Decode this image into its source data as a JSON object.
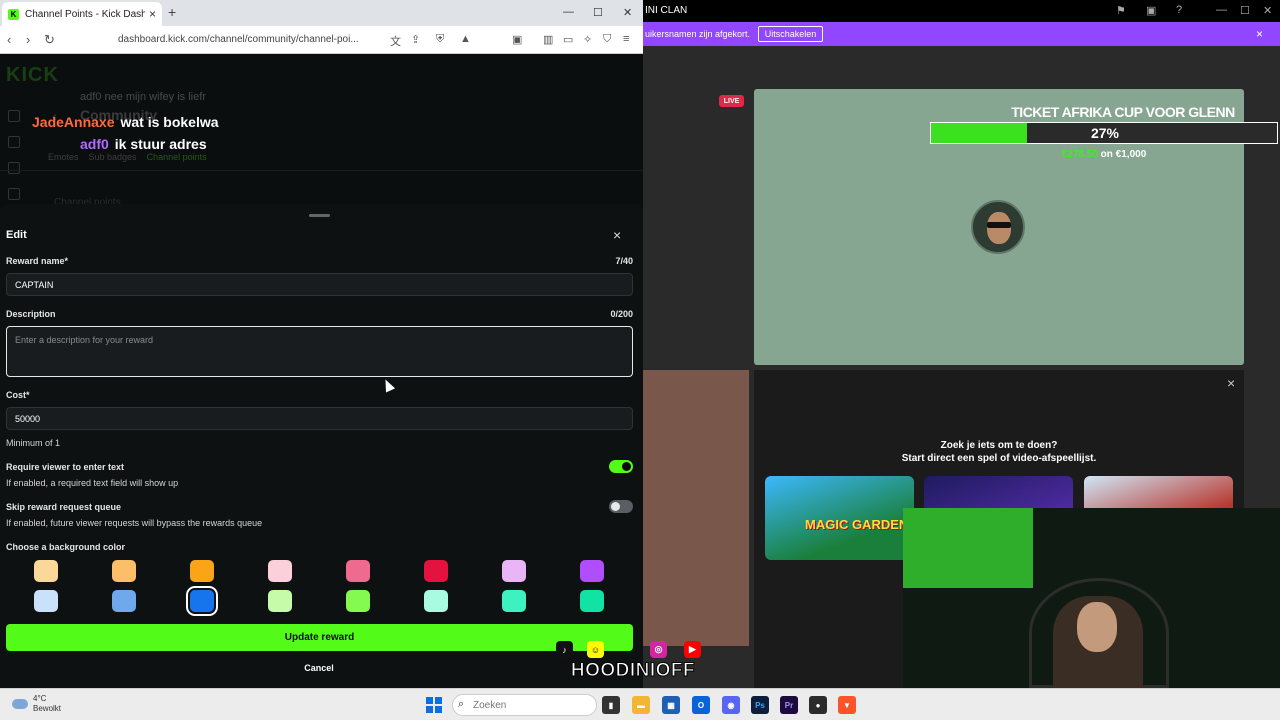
{
  "browser": {
    "tab_title": "Channel Points - Kick Dashboard",
    "tab_close": "×",
    "new_tab": "+",
    "url": "dashboard.kick.com/channel/community/channel-poi...",
    "nav": {
      "back": "‹",
      "forward": "›",
      "reload": "↻"
    }
  },
  "dashboard": {
    "logo": "KICK",
    "back_label": "‹",
    "title": "Community",
    "subtabs": [
      "Emotes",
      "Sub badges",
      "Channel points"
    ],
    "section_label": "Channel points"
  },
  "chat_overlay": [
    {
      "user": "adf0",
      "message": "nee mijn wifey is liefr"
    },
    {
      "user": "JadeAnnaxe",
      "message": "wat is bokelwa"
    },
    {
      "user": "adf0",
      "message": "ik stuur adres"
    }
  ],
  "modal": {
    "title": "Edit",
    "close": "×",
    "reward_name_label": "Reward name*",
    "reward_name_count": "7/40",
    "reward_name_value": "CAPTAIN",
    "description_label": "Description",
    "description_count": "0/200",
    "description_placeholder": "Enter a description for your reward",
    "cost_label": "Cost*",
    "cost_value": "50000",
    "cost_hint": "Minimum of 1",
    "require_text_label": "Require viewer to enter text",
    "require_text_help": "If enabled, a required text field will show up",
    "require_text_on": true,
    "skip_queue_label": "Skip reward request queue",
    "skip_queue_help": "If enabled, future viewer requests will bypass the rewards queue",
    "skip_queue_on": false,
    "bg_color_label": "Choose a background color",
    "colors_row1": [
      "#fcd79a",
      "#fbbf6a",
      "#fba417",
      "#fbd0da",
      "#ee6a8f",
      "#e4123f",
      "#e8b5f7",
      "#b04dfc"
    ],
    "colors_row2": [
      "#c9e1fb",
      "#6fa8ec",
      "#1675ec",
      "#c6fca9",
      "#84f94f",
      "#a8fbe0",
      "#3df2c0",
      "#11e3a4"
    ],
    "selected_color": "#1675ec",
    "update_button": "Update reward",
    "cancel_button": "Cancel"
  },
  "stream": {
    "window_title": "INI CLAN",
    "banner_text": "uikersnamen zijn afgekort.",
    "banner_button": "Uitschakelen",
    "banner_close": "×",
    "live_badge": "LIVE",
    "goal": {
      "title": "TICKET AFRIKA CUP VOOR GLENN",
      "percent_label": "27%",
      "progress": 0.278,
      "amount_current": "€278.50",
      "amount_rest": "on €1,000"
    },
    "suggest_close": "×",
    "suggest_line1": "Zoek je iets om te doen?",
    "suggest_line2": "Start direct een spel of video-afspeellijst.",
    "game1_label": "MAGIC GARDEN",
    "streamer_handle": "HOODINIOFF"
  },
  "taskbar": {
    "temperature": "4°C",
    "weather": "Bewolkt",
    "search_placeholder": "Zoeken"
  },
  "accent_green": "#53fc18",
  "banner_purple": "#9146ff"
}
